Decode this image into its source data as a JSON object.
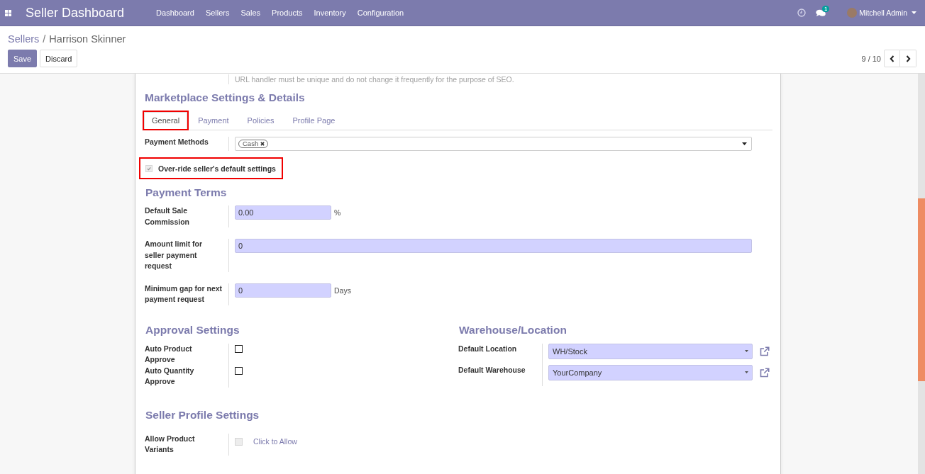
{
  "navbar": {
    "app_title": "Seller Dashboard",
    "menu": [
      "Dashboard",
      "Sellers",
      "Sales",
      "Products",
      "Inventory",
      "Configuration"
    ],
    "chat_badge": "1",
    "user": "Mitchell Admin"
  },
  "control_panel": {
    "breadcrumb": [
      {
        "label": "Sellers",
        "kind": "link"
      },
      {
        "label": "/",
        "kind": "separator"
      },
      {
        "label": "Harrison Skinner",
        "kind": "current"
      }
    ],
    "buttons": [
      {
        "label": "Save",
        "kind": "primary"
      },
      {
        "label": "Discard",
        "kind": "secondary"
      }
    ],
    "pager": "9 / 10"
  },
  "form": {
    "hint": "URL handler must be unique and do not change it frequently for the purpose of SEO.",
    "title": "Marketplace Settings & Details",
    "tabs": [
      {
        "label": "General",
        "selected": true,
        "highlighted": true
      },
      {
        "label": "Payment",
        "selected": false,
        "highlighted": false
      },
      {
        "label": "Policies",
        "selected": false,
        "highlighted": false
      },
      {
        "label": "Profile Page",
        "selected": false,
        "highlighted": false
      }
    ],
    "payment_methods": {
      "label": "Payment Methods",
      "tags": [
        "Cash"
      ]
    },
    "override": {
      "label": "Over-ride seller's default settings",
      "checked": true,
      "disabled": true,
      "highlighted": true
    },
    "payment_terms": {
      "title": "Payment Terms",
      "fields": [
        {
          "label": "Default Sale Commission",
          "value": "0.00",
          "suffix": "%",
          "kind": "short"
        },
        {
          "label": "Amount limit for seller payment request",
          "value": "0",
          "kind": "wide"
        },
        {
          "label": "Minimum gap for next payment request",
          "value": "0",
          "suffix": "Days",
          "kind": "short"
        }
      ]
    },
    "approval": {
      "title": "Approval Settings",
      "items": [
        {
          "label": "Auto Product Approve",
          "checked": false,
          "disabled": false
        },
        {
          "label": "Auto Quantity Approve",
          "checked": false,
          "disabled": false
        }
      ]
    },
    "warehouse": {
      "title": "Warehouse/Location",
      "fields": [
        {
          "label": "Default Location",
          "value": "WH/Stock"
        },
        {
          "label": "Default Warehouse",
          "value": "YourCompany"
        }
      ]
    },
    "seller_profile": {
      "title": "Seller Profile Settings",
      "items": [
        {
          "label": "Allow Product Variants",
          "checked": false,
          "disabled": true,
          "caption": "Click to Allow"
        }
      ]
    }
  }
}
